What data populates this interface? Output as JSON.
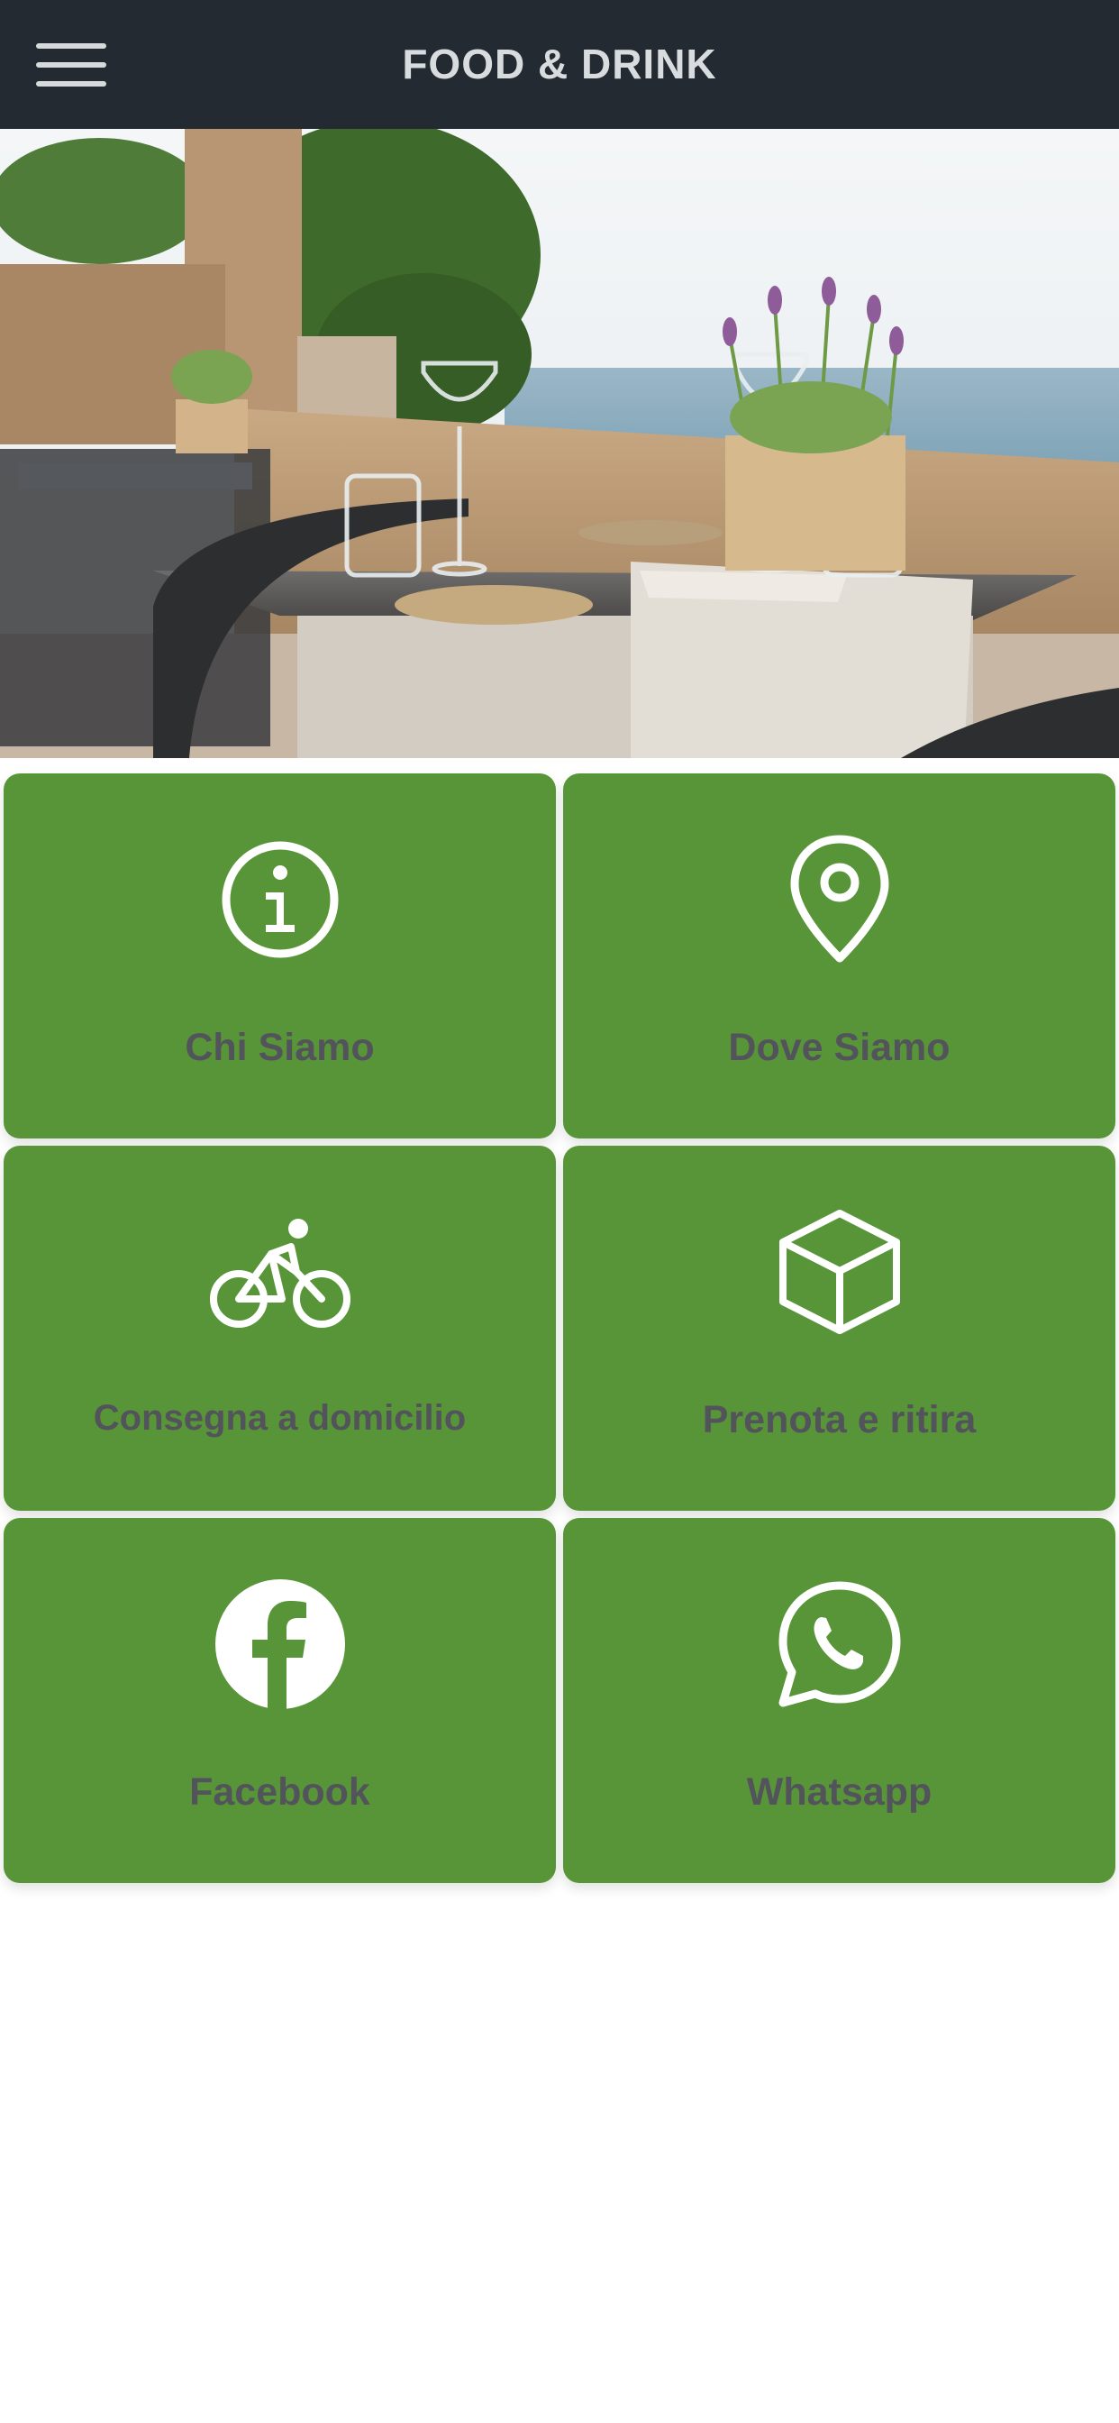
{
  "header": {
    "title": "FOOD & DRINK",
    "menu_icon": "hamburger-menu-icon",
    "background": "#232a31"
  },
  "hero": {
    "description_icon": "restaurant-terrace-photo"
  },
  "tiles": [
    {
      "label": "Chi Siamo",
      "icon": "info-icon"
    },
    {
      "label": "Dove Siamo",
      "icon": "map-pin-icon"
    },
    {
      "label": "Consegna a domicilio",
      "icon": "bicycle-icon"
    },
    {
      "label": "Prenota e ritira",
      "icon": "box-icon"
    },
    {
      "label": "Facebook",
      "icon": "facebook-icon"
    },
    {
      "label": "Whatsapp",
      "icon": "whatsapp-icon"
    }
  ],
  "colors": {
    "tile_green": "#589538",
    "label_text": "#53535c",
    "icon_white": "#ffffff"
  }
}
